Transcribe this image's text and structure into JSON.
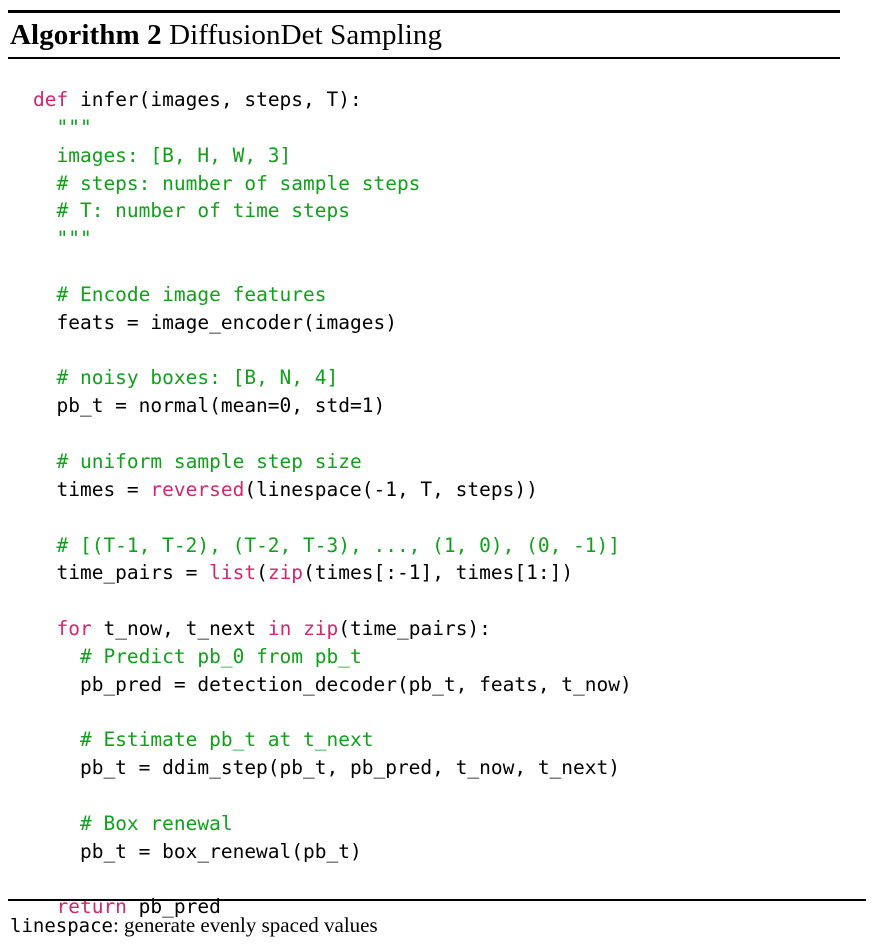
{
  "figure": {
    "title": {
      "label": "Algorithm 2",
      "name": "DiffusionDet Sampling"
    },
    "footnote": {
      "mono": "linespace",
      "text": ": generate evenly spaced values"
    },
    "colors": {
      "keyword": "#d2276e",
      "builtin": "#d2276e",
      "comment": "#11a01b",
      "string": "#11a01b",
      "plain": "#000000",
      "rule": "#000000",
      "background": "#ffffff"
    },
    "code_lines": [
      {
        "id": "l01",
        "tokens": [
          {
            "t": "def",
            "c": "kw"
          },
          {
            "t": " infer(images, steps, T):",
            "c": "pl"
          }
        ]
      },
      {
        "id": "l02",
        "tokens": [
          {
            "t": "  ",
            "c": "pl"
          },
          {
            "t": "\"\"\"",
            "c": "str"
          }
        ]
      },
      {
        "id": "l03",
        "tokens": [
          {
            "t": "  ",
            "c": "pl"
          },
          {
            "t": "images: [B, H, W, 3]",
            "c": "str"
          }
        ]
      },
      {
        "id": "l04",
        "tokens": [
          {
            "t": "  ",
            "c": "pl"
          },
          {
            "t": "# steps: number of sample steps",
            "c": "str"
          }
        ]
      },
      {
        "id": "l05",
        "tokens": [
          {
            "t": "  ",
            "c": "pl"
          },
          {
            "t": "# T: number of time steps",
            "c": "str"
          }
        ]
      },
      {
        "id": "l06",
        "tokens": [
          {
            "t": "  ",
            "c": "pl"
          },
          {
            "t": "\"\"\"",
            "c": "str"
          }
        ]
      },
      {
        "id": "l07",
        "tokens": [
          {
            "t": "",
            "c": "pl"
          }
        ]
      },
      {
        "id": "l08",
        "tokens": [
          {
            "t": "  ",
            "c": "pl"
          },
          {
            "t": "# Encode image features",
            "c": "cm"
          }
        ]
      },
      {
        "id": "l09",
        "tokens": [
          {
            "t": "  feats = image_encoder(images)",
            "c": "pl"
          }
        ]
      },
      {
        "id": "l10",
        "tokens": [
          {
            "t": "",
            "c": "pl"
          }
        ]
      },
      {
        "id": "l11",
        "tokens": [
          {
            "t": "  ",
            "c": "pl"
          },
          {
            "t": "# noisy boxes: [B, N, 4]",
            "c": "cm"
          }
        ]
      },
      {
        "id": "l12",
        "tokens": [
          {
            "t": "  pb_t = normal(mean=0, std=1)",
            "c": "pl"
          }
        ]
      },
      {
        "id": "l13",
        "tokens": [
          {
            "t": "",
            "c": "pl"
          }
        ]
      },
      {
        "id": "l14",
        "tokens": [
          {
            "t": "  ",
            "c": "pl"
          },
          {
            "t": "# uniform sample step size",
            "c": "cm"
          }
        ]
      },
      {
        "id": "l15",
        "tokens": [
          {
            "t": "  times = ",
            "c": "pl"
          },
          {
            "t": "reversed",
            "c": "bi"
          },
          {
            "t": "(linespace(-1, T, steps))",
            "c": "pl"
          }
        ]
      },
      {
        "id": "l16",
        "tokens": [
          {
            "t": "",
            "c": "pl"
          }
        ]
      },
      {
        "id": "l17",
        "tokens": [
          {
            "t": "  ",
            "c": "pl"
          },
          {
            "t": "# [(T-1, T-2), (T-2, T-3), ..., (1, 0), (0, -1)]",
            "c": "cm"
          }
        ]
      },
      {
        "id": "l18",
        "tokens": [
          {
            "t": "  time_pairs = ",
            "c": "pl"
          },
          {
            "t": "list",
            "c": "bi"
          },
          {
            "t": "(",
            "c": "pl"
          },
          {
            "t": "zip",
            "c": "bi"
          },
          {
            "t": "(times[:-1], times[1:])",
            "c": "pl"
          }
        ]
      },
      {
        "id": "l19",
        "tokens": [
          {
            "t": "",
            "c": "pl"
          }
        ]
      },
      {
        "id": "l20",
        "tokens": [
          {
            "t": "  ",
            "c": "pl"
          },
          {
            "t": "for",
            "c": "kw"
          },
          {
            "t": " t_now, t_next ",
            "c": "pl"
          },
          {
            "t": "in",
            "c": "kw"
          },
          {
            "t": " ",
            "c": "pl"
          },
          {
            "t": "zip",
            "c": "bi"
          },
          {
            "t": "(time_pairs):",
            "c": "pl"
          }
        ]
      },
      {
        "id": "l21",
        "tokens": [
          {
            "t": "    ",
            "c": "pl"
          },
          {
            "t": "# Predict pb_0 from pb_t",
            "c": "cm"
          }
        ]
      },
      {
        "id": "l22",
        "tokens": [
          {
            "t": "    pb_pred = detection_decoder(pb_t, feats, t_now)",
            "c": "pl"
          }
        ]
      },
      {
        "id": "l23",
        "tokens": [
          {
            "t": "",
            "c": "pl"
          }
        ]
      },
      {
        "id": "l24",
        "tokens": [
          {
            "t": "    ",
            "c": "pl"
          },
          {
            "t": "# Estimate pb_t at t_next",
            "c": "cm"
          }
        ]
      },
      {
        "id": "l25",
        "tokens": [
          {
            "t": "    pb_t = ddim_step(pb_t, pb_pred, t_now, t_next)",
            "c": "pl"
          }
        ]
      },
      {
        "id": "l26",
        "tokens": [
          {
            "t": "",
            "c": "pl"
          }
        ]
      },
      {
        "id": "l27",
        "tokens": [
          {
            "t": "    ",
            "c": "pl"
          },
          {
            "t": "# Box renewal",
            "c": "cm"
          }
        ]
      },
      {
        "id": "l28",
        "tokens": [
          {
            "t": "    pb_t = box_renewal(pb_t)",
            "c": "pl"
          }
        ]
      },
      {
        "id": "l29",
        "tokens": [
          {
            "t": "",
            "c": "pl"
          }
        ]
      },
      {
        "id": "l30",
        "tokens": [
          {
            "t": "  ",
            "c": "pl"
          },
          {
            "t": "return",
            "c": "kw"
          },
          {
            "t": " pb_pred",
            "c": "pl"
          }
        ]
      }
    ]
  }
}
